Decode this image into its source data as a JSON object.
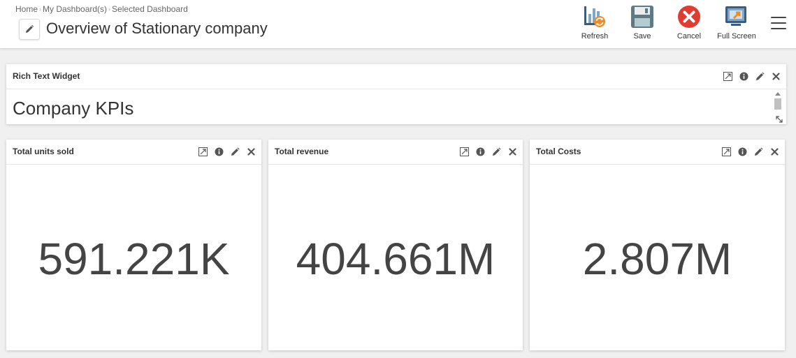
{
  "header": {
    "breadcrumb": [
      "Home",
      "My Dashboard(s)",
      "Selected Dashboard"
    ],
    "title": "Overview of Stationary company",
    "actions": {
      "refresh": "Refresh",
      "save": "Save",
      "cancel": "Cancel",
      "fullscreen": "Full Screen"
    }
  },
  "widgets": {
    "rich_text": {
      "title": "Rich Text Widget",
      "content": "Company KPIs"
    },
    "kpis": [
      {
        "title": "Total units sold",
        "value": "591.221K"
      },
      {
        "title": "Total revenue",
        "value": "404.661M"
      },
      {
        "title": "Total Costs",
        "value": "2.807M"
      }
    ]
  },
  "icons": {
    "tools": [
      "expand-icon",
      "info-icon",
      "pencil-icon",
      "close-icon"
    ]
  },
  "colors": {
    "cancel_red": "#e03c31",
    "refresh_orange": "#f08a24",
    "text": "#333333"
  }
}
